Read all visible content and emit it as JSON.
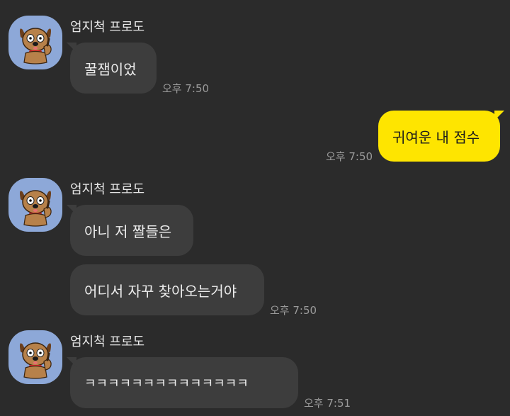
{
  "messages": [
    {
      "sender": "엄지척 프로도",
      "bubbles": [
        "꿀잼이었"
      ],
      "time": "오후 7:50"
    },
    {
      "mine": true,
      "bubbles": [
        "귀여운 내 점수"
      ],
      "time": "오후 7:50"
    },
    {
      "sender": "엄지척 프로도",
      "bubbles": [
        "아니 저 짤들은",
        "어디서 자꾸 찾아오는거야"
      ],
      "time": "오후 7:50"
    },
    {
      "sender": "엄지척 프로도",
      "bubbles": [
        "ㅋㅋㅋㅋㅋㅋㅋㅋㅋㅋㅋㅋㅋㅋ"
      ],
      "time": "오후 7:51"
    }
  ],
  "colors": {
    "background": "#2b2b2b",
    "incoming_bubble": "#3d3d3d",
    "outgoing_bubble": "#fee500",
    "avatar_background": "#8da8d8"
  },
  "icons": {
    "avatar": "dog-character-thumbs-up"
  }
}
